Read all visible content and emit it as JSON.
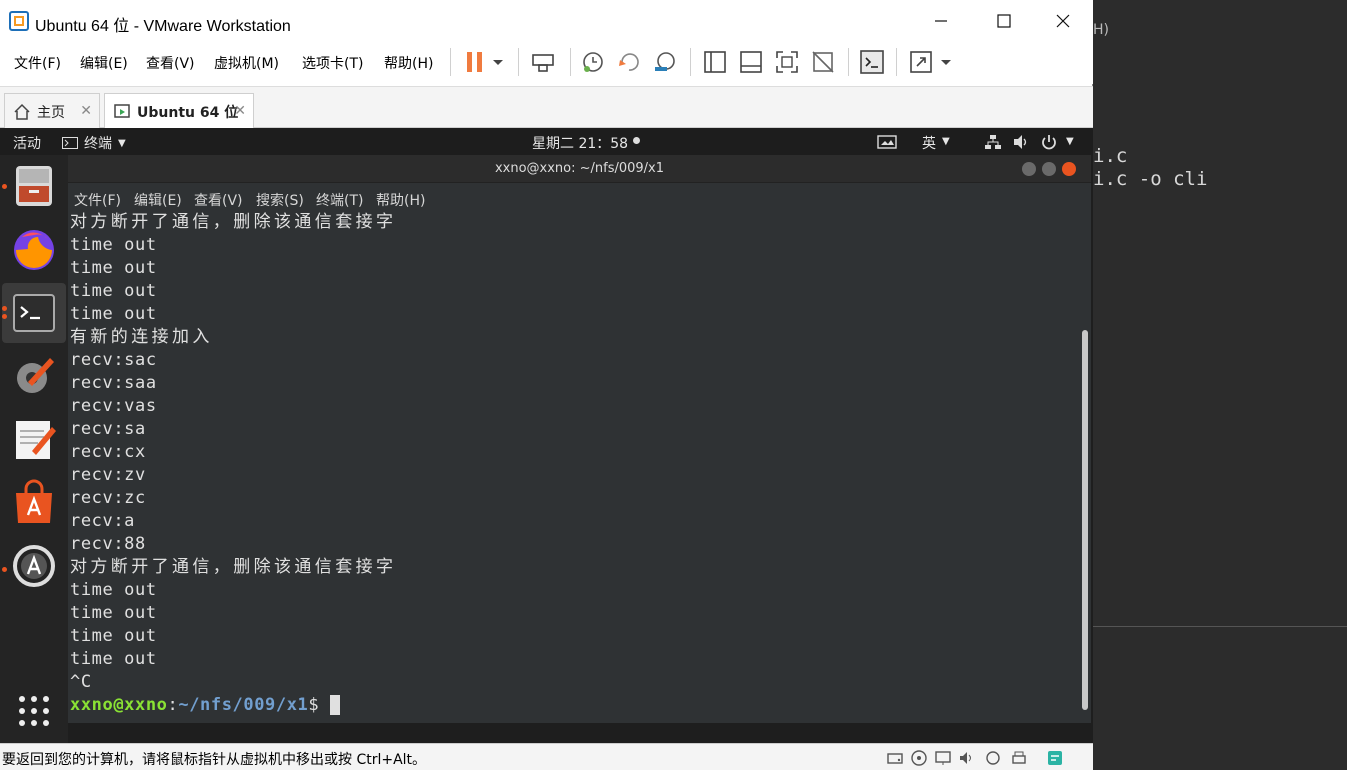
{
  "window": {
    "title": "Ubuntu 64 位 - VMware Workstation",
    "min_icon": "minimize-icon",
    "max_icon": "maximize-icon",
    "close_icon": "close-icon"
  },
  "vm_menu": [
    "文件(F)",
    "编辑(E)",
    "查看(V)",
    "虚拟机(M)",
    "选项卡(T)",
    "帮助(H)"
  ],
  "tabs": [
    {
      "label": "主页",
      "icon": "home-icon"
    },
    {
      "label": "Ubuntu 64 位",
      "icon": "vm-icon"
    }
  ],
  "ubuntu_topbar": {
    "activities": "活动",
    "app_menu": "终端",
    "clock": "星期二 21：58",
    "input_method": "英"
  },
  "terminal": {
    "title": "xxno@xxno: ~/nfs/009/x1",
    "menu": [
      "文件(F)",
      "编辑(E)",
      "查看(V)",
      "搜索(S)",
      "终端(T)",
      "帮助(H)"
    ],
    "lines": [
      "对方断开了通信，删除该通信套接字",
      "time out",
      "time out",
      "time out",
      "time out",
      "有新的连接加入",
      "recv:sac",
      "recv:saa",
      "recv:vas",
      "recv:sa",
      "recv:cx",
      "recv:zv",
      "recv:zc",
      "recv:a",
      "recv:88",
      "对方断开了通信，删除该通信套接字",
      "time out",
      "time out",
      "time out",
      "time out",
      "^C"
    ],
    "prompt_user": "xxno@xxno",
    "prompt_path": "~/nfs/009/x1",
    "prompt_symbol": "$"
  },
  "status_bar": {
    "message": "要返回到您的计算机，请将鼠标指针从虚拟机中移出或按 Ctrl+Alt。"
  },
  "background_terminal": {
    "top_text": "H)",
    "line1": "i.c",
    "line2": "i.c -o cli"
  },
  "colors": {
    "ubuntu_orange": "#e95420",
    "prompt_green": "#8ae234",
    "prompt_blue": "#729fcf",
    "pause_orange": "#f07b3f"
  }
}
